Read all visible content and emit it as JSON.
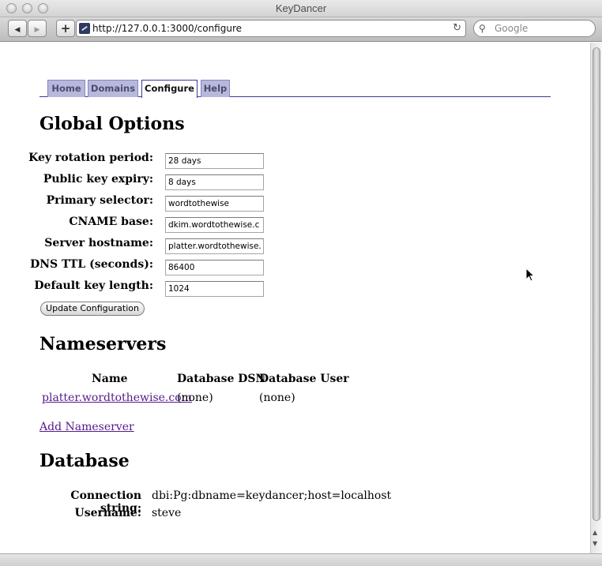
{
  "window": {
    "title": "KeyDancer"
  },
  "toolbar": {
    "back": "◀",
    "forward": "▶",
    "add": "+",
    "url": "http://127.0.0.1:3000/configure",
    "reload": "↻",
    "search_placeholder": "Google",
    "search_icon": "⚲"
  },
  "tabs": [
    {
      "label": "Home"
    },
    {
      "label": "Domains"
    },
    {
      "label": "Configure"
    },
    {
      "label": "Help"
    }
  ],
  "global_options": {
    "heading": "Global Options",
    "fields": [
      {
        "label": "Key rotation period:",
        "value": "28 days"
      },
      {
        "label": "Public key expiry:",
        "value": "8 days"
      },
      {
        "label": "Primary selector:",
        "value": "wordtothewise"
      },
      {
        "label": "CNAME base:",
        "value": "dkim.wordtothewise.c"
      },
      {
        "label": "Server hostname:",
        "value": "platter.wordtothewise."
      },
      {
        "label": "DNS TTL (seconds):",
        "value": "86400"
      },
      {
        "label": "Default key length:",
        "value": "1024"
      }
    ],
    "update_button": "Update Configuration"
  },
  "nameservers": {
    "heading": "Nameservers",
    "columns": [
      "Name",
      "Database DSN",
      "Database User"
    ],
    "rows": [
      {
        "name": "platter.wordtothewise.com",
        "dsn": "(none)",
        "user": "(none)"
      }
    ],
    "add_link": "Add Nameserver"
  },
  "database": {
    "heading": "Database",
    "connection_label": "Connection string:",
    "connection_value": "dbi:Pg:dbname=keydancer;host=localhost",
    "username_label": "Username:",
    "username_value": "steve"
  }
}
